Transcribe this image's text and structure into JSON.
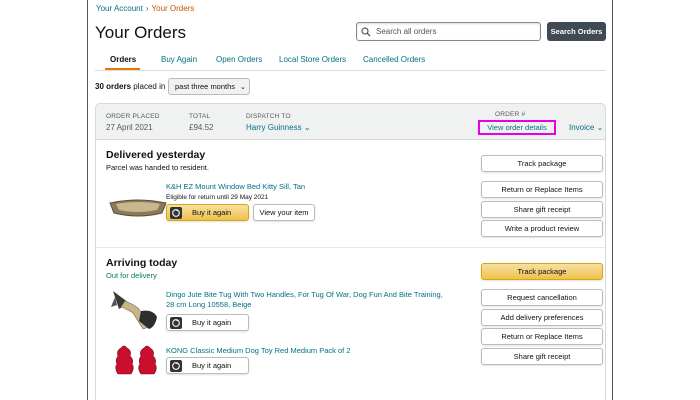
{
  "breadcrumb": {
    "account": "Your Account",
    "separator": "›",
    "orders": "Your Orders"
  },
  "page_title": "Your Orders",
  "search": {
    "placeholder": "Search all orders",
    "button": "Search Orders"
  },
  "tabs": [
    {
      "label": "Orders",
      "active": true
    },
    {
      "label": "Buy Again"
    },
    {
      "label": "Open Orders"
    },
    {
      "label": "Local Store Orders"
    },
    {
      "label": "Cancelled Orders"
    }
  ],
  "summary": {
    "count": "30 orders",
    "placed_in": "placed in",
    "period": "past three months"
  },
  "order": {
    "placed_label": "ORDER PLACED",
    "placed_value": "27 April 2021",
    "total_label": "TOTAL",
    "total_value": "£94.52",
    "dispatch_label": "DISPATCH TO",
    "dispatch_value": "Harry Guinness",
    "order_label": "ORDER #",
    "details_link": "View order details",
    "invoice": "Invoice"
  },
  "shipment1": {
    "status": "Delivered yesterday",
    "note": "Parcel was handed to resident.",
    "item": {
      "name": "K&H EZ Mount Window Bed Kitty Sill, Tan",
      "eligibility": "Eligible for return until 29 May 2021",
      "buy_again": "Buy it again",
      "view_item": "View your item"
    },
    "actions": [
      "Track package",
      "Return or Replace Items",
      "Share gift receipt",
      "Write a product review"
    ]
  },
  "shipment2": {
    "status": "Arriving today",
    "note": "Out for delivery",
    "items": [
      {
        "name_line1": "Dingo Jute Bite Tug With Two Handles, For Tug Of War, Dog Fun And Bite Training,",
        "name_line2": "28 cm Long 10558, Beige",
        "buy_again": "Buy it again"
      },
      {
        "name_line1": "KONG Classic Medium Dog Toy Red Medium Pack of 2",
        "buy_again": "Buy it again"
      }
    ],
    "actions": [
      "Track package",
      "Request cancellation",
      "Add delivery preferences",
      "Return or Replace Items",
      "Share gift receipt"
    ]
  },
  "colors": {
    "link": "#007185",
    "accent_orange": "#e77600",
    "highlight": "#e600e6",
    "button_yellow": "#f0c14b"
  }
}
